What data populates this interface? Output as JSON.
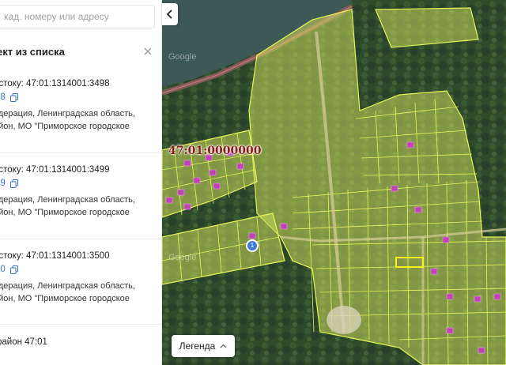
{
  "search": {
    "placeholder": "кад. номеру или адресу"
  },
  "list": {
    "title": "ект из списка",
    "items": [
      {
        "title": "астоку: 47:01:1314001:3498",
        "number": "98",
        "addr1": "едерация, Ленинградская область,",
        "addr2": "айон, МО \"Приморское городское"
      },
      {
        "title": "астоку: 47:01:1314001:3499",
        "number": "99",
        "addr1": "едерация, Ленинградская область,",
        "addr2": "айон, МО \"Приморское городское"
      },
      {
        "title": "астоку: 47:01:1314001:3500",
        "number": "00",
        "addr1": "едерация, Ленинградская область,",
        "addr2": "айон, МО \"Приморское городское"
      }
    ],
    "district": "район 47:01"
  },
  "map": {
    "cadastral_label": "47:01:0000000",
    "watermark": "Google",
    "pin_label": "1",
    "legend_label": "Легенда"
  },
  "colors": {
    "parcel_stroke": "#e8f55a",
    "parcel_fill": "#c8d85a",
    "building": "#c040b8",
    "link": "#3a6fd8"
  }
}
